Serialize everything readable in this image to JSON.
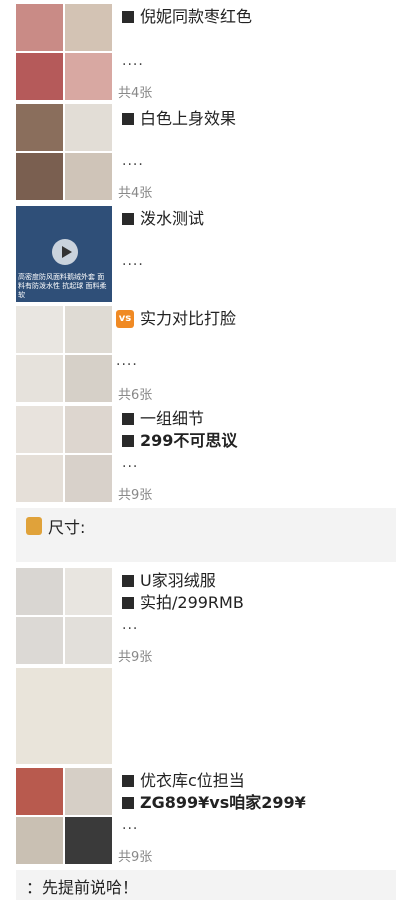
{
  "posts": [
    {
      "lines": [
        "倪妮同款枣红色"
      ],
      "dots": "....",
      "count": "共4张",
      "tiles": [
        "#c98b86",
        "#d3c3b4",
        "#b55a5a",
        "#d8a8a2"
      ]
    },
    {
      "lines": [
        "白色上身效果"
      ],
      "dots": "....",
      "count": "共4张",
      "tiles": [
        "#8a6e5c",
        "#e2ddd6",
        "#7a5f50",
        "#cfc4b8"
      ]
    },
    {
      "lines": [
        "泼水测试"
      ],
      "dots": "....",
      "video_caption": "高密度防风面料鹅绒外套 面料有防泼水性 抗起球 面料柔软",
      "tiles": [
        "#2f4f78"
      ]
    },
    {
      "lines": [
        "实力对比打脸"
      ],
      "vs_label": "vs",
      "dots": "....",
      "count": "共6张",
      "tiles": [
        "#e9e6e1",
        "#dfdbd4",
        "#e6e2dc",
        "#d6d0c8"
      ]
    },
    {
      "lines": [
        "一组细节",
        "299不可思议"
      ],
      "dots": "...",
      "count": "共9张",
      "tiles": [
        "#e8e3dd",
        "#ddd6cf",
        "#e5dfd8",
        "#d8d1ca"
      ]
    }
  ],
  "size_note": "尺寸:",
  "post2": [
    {
      "lines": [
        "U家羽绒服",
        "实拍/299RMB"
      ],
      "dots": "...",
      "count": "共9张",
      "tiles": [
        "#d9d6d2",
        "#e8e5e0",
        "#dcd9d5",
        "#e2dfda"
      ]
    },
    {
      "tiles": [
        "#e9e4da"
      ]
    },
    {
      "lines": [
        "优衣库c位担当",
        "ZG899¥vs咱家299¥"
      ],
      "dots": "...",
      "count": "共9张",
      "tiles": [
        "#b85a4e",
        "#d6cfc6",
        "#c9c0b3",
        "#3a3a3a"
      ]
    }
  ],
  "footer_note": "：先提前说哈！"
}
